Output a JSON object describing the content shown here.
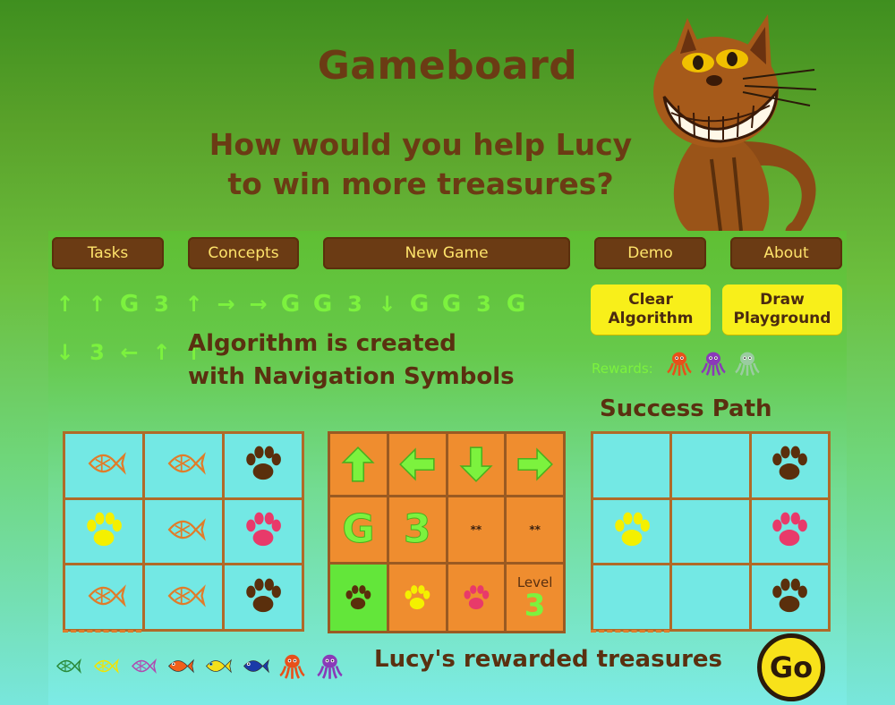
{
  "header": {
    "title": "Gameboard",
    "subtitle_line1": "How would you help Lucy",
    "subtitle_line2": "to win more treasures?"
  },
  "nav": {
    "tasks": "Tasks",
    "concepts": "Concepts",
    "new_game": "New Game",
    "demo": "Demo",
    "about": "About"
  },
  "actions": {
    "clear_line1": "Clear",
    "clear_line2": "Algorithm",
    "draw_line1": "Draw",
    "draw_line2": "Playground"
  },
  "algorithm": {
    "symbols": [
      "↑",
      "↑",
      "G",
      "3",
      "↑",
      "→",
      "→",
      "G",
      "G",
      "3",
      "↓",
      "G",
      "G",
      "3",
      "G",
      "↓",
      "3",
      "←",
      "↑",
      "↑"
    ],
    "caption_line1": "Algorithm is created",
    "caption_line2": "with Navigation Symbols"
  },
  "rewards": {
    "label": "Rewards:",
    "icons": [
      "octopus-icon",
      "jellyfish-icon",
      "squid-icon"
    ]
  },
  "success_path": {
    "title": "Success Path"
  },
  "playground": {
    "cells": [
      "fish-outline",
      "fish-outline",
      "paw-brown",
      "paw-yellow",
      "fish-outline",
      "paw-pink",
      "fish-outline",
      "fish-outline",
      "paw-brown"
    ]
  },
  "symbols_board": {
    "star_text": "**",
    "level_label": "Level",
    "level_value": "3"
  },
  "success_cells": [
    "",
    "",
    "paw-brown",
    "paw-yellow",
    "",
    "paw-pink",
    "",
    "",
    "paw-brown"
  ],
  "treasures": {
    "label": "Lucy's rewarded treasures",
    "items": [
      "fish-outline-green",
      "fish-outline-yellow",
      "fish-outline-purple",
      "goldfish",
      "yellow-fish",
      "blue-fish",
      "octopus",
      "jellyfish"
    ]
  },
  "go": {
    "label": "Go"
  },
  "colors": {
    "brown": "#6b3b14",
    "lime": "#7cf23e",
    "yellow": "#f8ef1a",
    "orange": "#ef8d2f",
    "cyan": "#73e8e4"
  }
}
